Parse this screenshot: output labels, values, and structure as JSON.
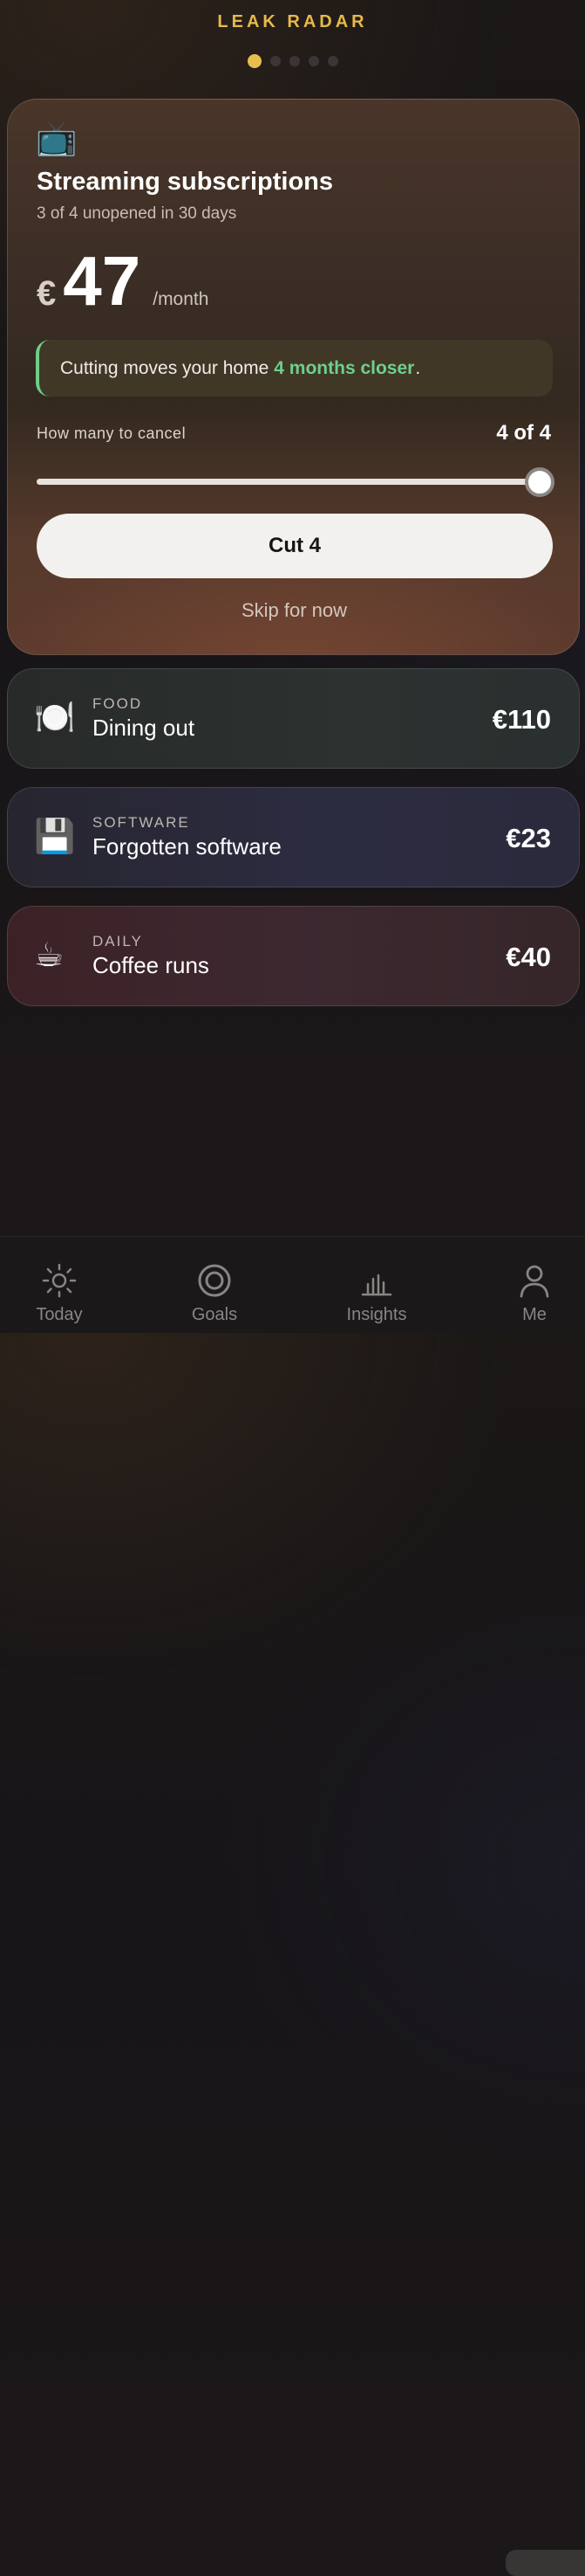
{
  "header": {
    "title": "LEAK RADAR",
    "pager": {
      "count": 5,
      "active_index": 0
    }
  },
  "hero": {
    "icon": "tv-icon",
    "title": "Streaming subscriptions",
    "subtitle": "3 of 4 unopened in 30 days",
    "currency": "€",
    "amount": "47",
    "period": "/month",
    "callout": {
      "prefix": "Cutting moves your home",
      "highlight": "4 months closer",
      "suffix": "."
    },
    "cancel_label": "How many to cancel",
    "cancel_value": "4 of 4",
    "slider": {
      "value": 4,
      "max": 4
    },
    "cut_button": "Cut 4",
    "skip_link": "Skip for now"
  },
  "leaks": [
    {
      "icon": "plate-icon",
      "category": "FOOD",
      "name": "Dining out",
      "amount": "€110"
    },
    {
      "icon": "floppy-disk-icon",
      "category": "SOFTWARE",
      "name": "Forgotten software",
      "amount": "€23"
    },
    {
      "icon": "coffee-cup-icon",
      "category": "DAILY",
      "name": "Coffee runs",
      "amount": "€40"
    }
  ],
  "nav": [
    {
      "icon": "sun-icon",
      "label": "Today"
    },
    {
      "icon": "target-icon",
      "label": "Goals"
    },
    {
      "icon": "bar-chart-icon",
      "label": "Insights"
    },
    {
      "icon": "person-icon",
      "label": "Me"
    }
  ],
  "colors": {
    "accent": "#e8bd4e",
    "positive": "#6dd08c",
    "background": "#171518"
  }
}
